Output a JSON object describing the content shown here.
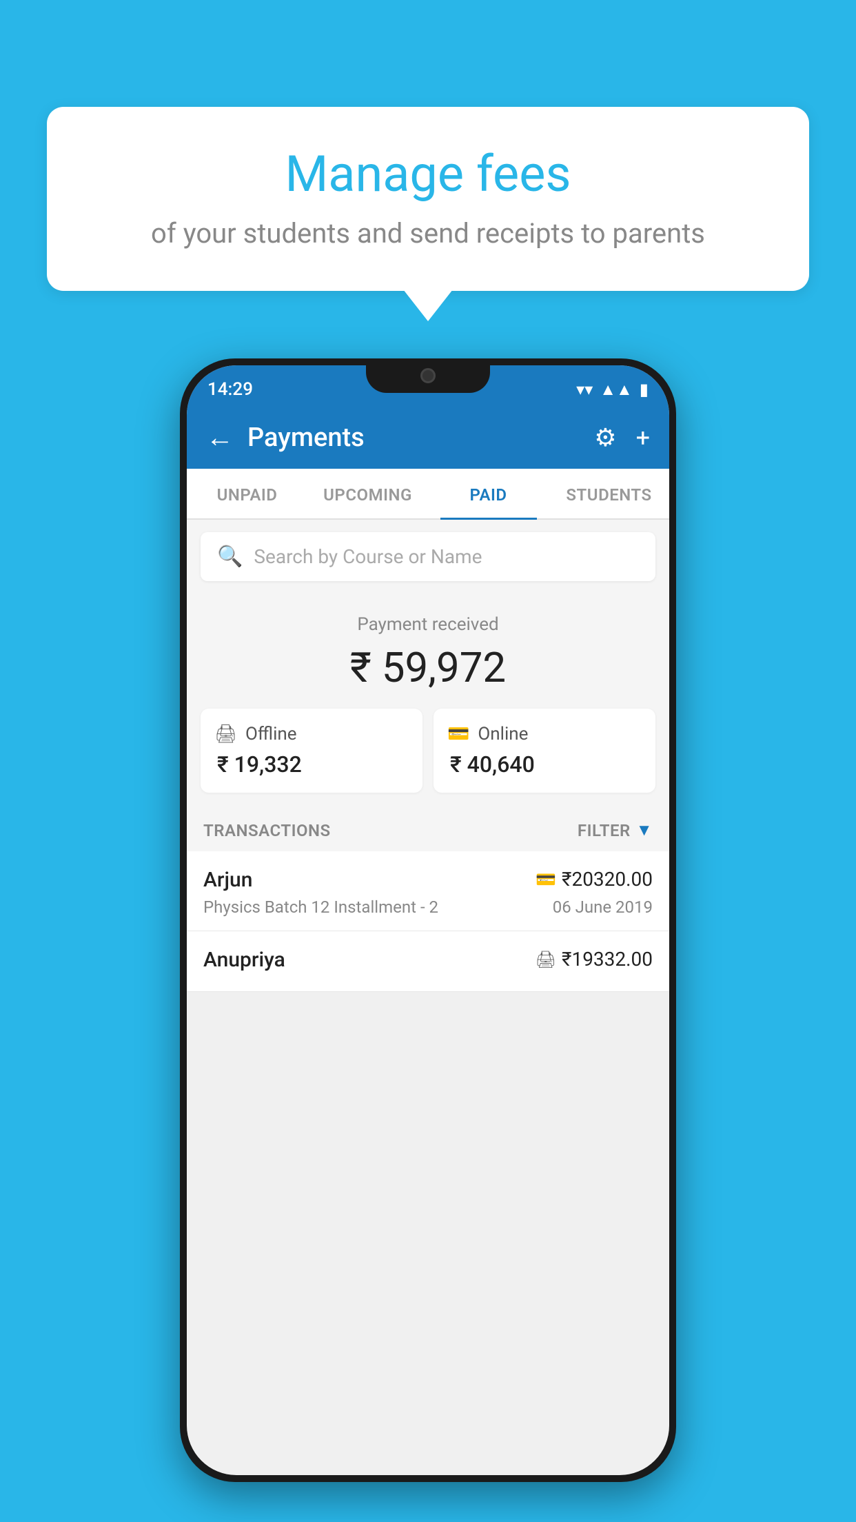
{
  "background": {
    "color": "#29b6e8"
  },
  "bubble": {
    "title": "Manage fees",
    "subtitle": "of your students and send receipts to parents"
  },
  "statusBar": {
    "time": "14:29",
    "wifi": "▲",
    "signal": "▲",
    "battery": "▌"
  },
  "header": {
    "title": "Payments",
    "backLabel": "←",
    "settingsLabel": "⚙",
    "addLabel": "+"
  },
  "tabs": [
    {
      "label": "UNPAID",
      "active": false
    },
    {
      "label": "UPCOMING",
      "active": false
    },
    {
      "label": "PAID",
      "active": true
    },
    {
      "label": "STUDENTS",
      "active": false
    }
  ],
  "search": {
    "placeholder": "Search by Course or Name"
  },
  "payment": {
    "label": "Payment received",
    "amount": "₹ 59,972",
    "offline": {
      "type": "Offline",
      "amount": "₹ 19,332"
    },
    "online": {
      "type": "Online",
      "amount": "₹ 40,640"
    }
  },
  "transactions": {
    "sectionLabel": "TRANSACTIONS",
    "filterLabel": "FILTER",
    "items": [
      {
        "name": "Arjun",
        "course": "Physics Batch 12 Installment - 2",
        "amount": "₹20320.00",
        "date": "06 June 2019",
        "paymentType": "online"
      },
      {
        "name": "Anupriya",
        "course": "",
        "amount": "₹19332.00",
        "date": "",
        "paymentType": "offline"
      }
    ]
  }
}
